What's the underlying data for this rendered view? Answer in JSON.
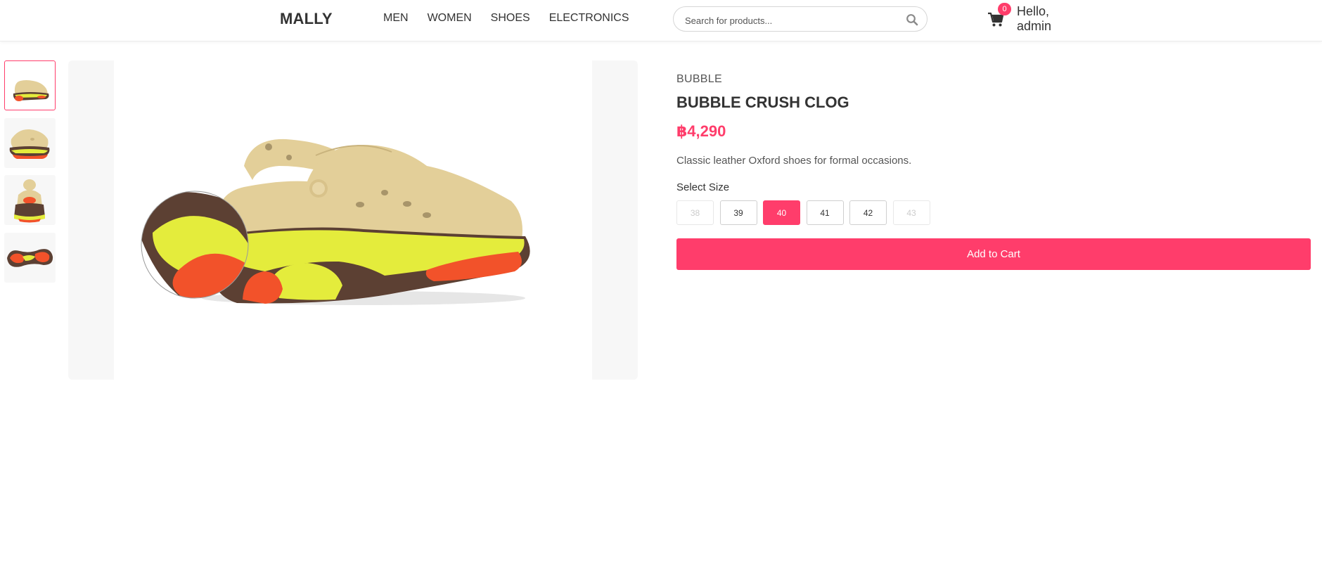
{
  "header": {
    "logo": "MALLY",
    "nav": [
      "MEN",
      "WOMEN",
      "SHOES",
      "ELECTRONICS"
    ],
    "search_placeholder": "Search for products...",
    "search_icon": "search-icon",
    "cart_icon": "cart-icon",
    "cart_count": "0",
    "greeting_line1": "Hello,",
    "greeting_line2": "admin"
  },
  "gallery": {
    "thumbnails": [
      "thumbnail-1",
      "thumbnail-2",
      "thumbnail-3",
      "thumbnail-4"
    ],
    "active_thumbnail": 0
  },
  "product": {
    "brand": "BUBBLE",
    "name": "BUBBLE CRUSH CLOG",
    "price": "฿4,290",
    "description": "Classic leather Oxford shoes for formal occasions.",
    "size_label": "Select Size",
    "sizes": [
      {
        "label": "38",
        "state": "disabled"
      },
      {
        "label": "39",
        "state": "available"
      },
      {
        "label": "40",
        "state": "selected"
      },
      {
        "label": "41",
        "state": "available"
      },
      {
        "label": "42",
        "state": "available"
      },
      {
        "label": "43",
        "state": "disabled"
      }
    ],
    "add_to_cart_label": "Add to Cart"
  },
  "colors": {
    "accent": "#ff3d6b",
    "clog_upper": "#e3cf99",
    "sole_brown": "#5c4033",
    "sole_yellow": "#e4ec3c",
    "sole_orange": "#f2522a"
  }
}
